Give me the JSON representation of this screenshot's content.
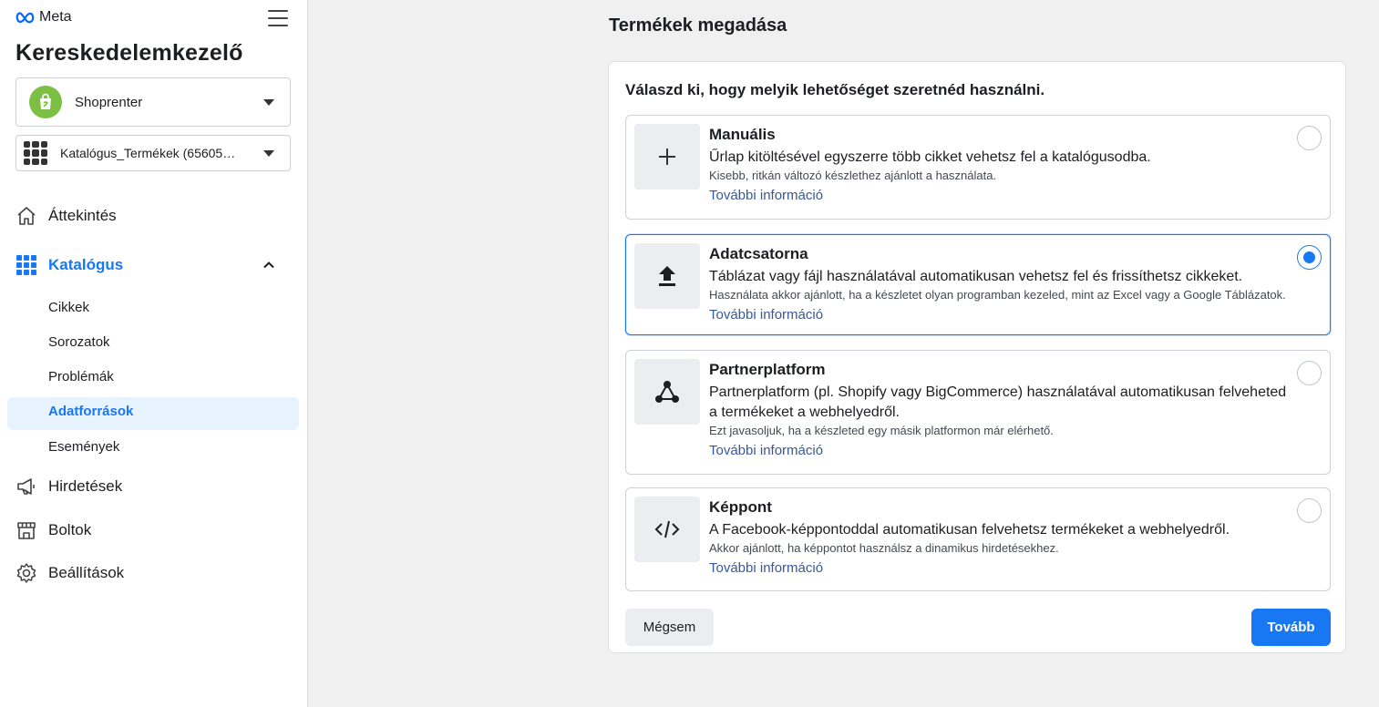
{
  "brand": {
    "logo_text": "Meta"
  },
  "sidebar": {
    "app_title": "Kereskedelemkezelő",
    "shop_selector": {
      "value": "Shoprenter"
    },
    "catalog_selector": {
      "value": "Katalógus_Termékek (65605…"
    },
    "nav": [
      {
        "label": "Áttekintés",
        "icon": "home-icon"
      },
      {
        "label": "Katalógus",
        "icon": "grid-icon",
        "active": true
      },
      {
        "label": "Hirdetések",
        "icon": "megaphone-icon"
      },
      {
        "label": "Boltok",
        "icon": "store-icon"
      },
      {
        "label": "Beállítások",
        "icon": "gear-icon"
      }
    ],
    "catalog_sub": [
      {
        "label": "Cikkek"
      },
      {
        "label": "Sorozatok"
      },
      {
        "label": "Problémák"
      },
      {
        "label": "Adatforrások",
        "active": true
      },
      {
        "label": "Események"
      }
    ]
  },
  "main": {
    "title": "Termékek megadása",
    "question": "Válaszd ki, hogy melyik lehetőséget szeretnéd használni.",
    "options": [
      {
        "title": "Manuális",
        "description": "Űrlap kitöltésével egyszerre több cikket vehetsz fel a katalógusodba.",
        "note": "Kisebb, ritkán változó készlethez ajánlott a használata.",
        "link": "További információ",
        "icon": "plus-icon",
        "selected": false
      },
      {
        "title": "Adatcsatorna",
        "description": "Táblázat vagy fájl használatával automatikusan vehetsz fel és frissíthetsz cikkeket.",
        "note": "Használata akkor ajánlott, ha a készletet olyan programban kezeled, mint az Excel vagy a Google Táblázatok.",
        "link": "További információ",
        "icon": "upload-icon",
        "selected": true
      },
      {
        "title": "Partnerplatform",
        "description": "Partnerplatform (pl. Shopify vagy BigCommerce) használatával automatikusan felveheted a termékeket a webhelyedről.",
        "note": "Ezt javasoljuk, ha a készleted egy másik platformon már elérhető.",
        "link": "További információ",
        "icon": "network-icon",
        "selected": false
      },
      {
        "title": "Képpont",
        "description": "A Facebook-képpontoddal automatikusan felvehetsz termékeket a webhelyedről.",
        "note": "Akkor ajánlott, ha képpontot használsz a dinamikus hirdetésekhez.",
        "link": "További információ",
        "icon": "code-icon",
        "selected": false
      }
    ],
    "cancel_label": "Mégsem",
    "next_label": "Tovább"
  },
  "colors": {
    "accent": "#1877f2",
    "selected_bg": "#e7f3ff",
    "link": "#385898"
  }
}
